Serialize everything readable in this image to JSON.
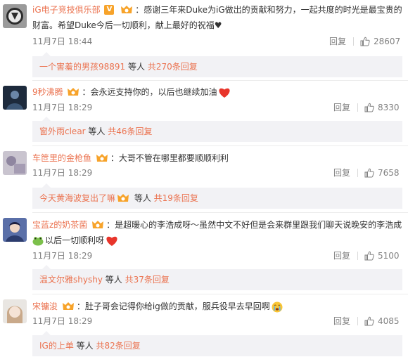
{
  "comments": [
    {
      "user": "iG电子竞技俱乐部",
      "verified_badge": "V",
      "text_line1": "：感谢三年来Duke为iG做出的贡献和努力，一起共度的时光是最宝贵的",
      "text_line2": "财富。希望Duke今后一切顺利，献上最好的祝福",
      "trailing_symbol": "♥",
      "time": "11月7日 18:44",
      "reply_label": "回复",
      "likes": "28607",
      "sub": {
        "user": "一个害羞的男孩98891",
        "etc": " 等人 ",
        "link": "共270条回复"
      }
    },
    {
      "user": "9秒沸腾",
      "text": "：会永远支持你的，以后也继续加油",
      "emoji": "red-heart",
      "time": "11月7日 18:29",
      "reply_label": "回复",
      "likes": "8330",
      "sub": {
        "user": "窗外雨clear",
        "etc": " 等人 ",
        "link": "共46条回复"
      }
    },
    {
      "user": "车笸里的金枪鱼",
      "text": "：大哥不管在哪里都要顺顺利利",
      "time": "11月7日 18:29",
      "reply_label": "回复",
      "likes": "7658",
      "sub": {
        "user": "今天黄海波复出了嘛",
        "etc": " 等人 ",
        "link": "共19条回复"
      }
    },
    {
      "user": "宝蓝z的奶茶菌",
      "text_line1": "：是超暖心的李浩成呀～虽然中文不好但是会来群里跟我们聊天说晚安的李浩成",
      "text_line2": "以后一切顺利呀",
      "emoji": "red-heart",
      "time": "11月7日 18:29",
      "reply_label": "回复",
      "likes": "5100",
      "sub": {
        "user": "温文尔雅shyshy",
        "etc": " 等人 ",
        "link": "共37条回复"
      }
    },
    {
      "user": "宋镛浚",
      "text": "：肚子哥会记得你给ig做的贡献，服兵役早去早回啊",
      "emoji": "crying-face",
      "time": "11月7日 18:29",
      "reply_label": "回复",
      "likes": "4085",
      "sub": {
        "user": "IG的上单",
        "etc": " 等人 ",
        "link": "共82条回复"
      }
    }
  ],
  "colors": {
    "username": "#eb7350",
    "meta": "#808080",
    "subbox_bg": "#f2f2f5",
    "badge_gold": "#f7a32a",
    "heart": "#e8352b"
  }
}
